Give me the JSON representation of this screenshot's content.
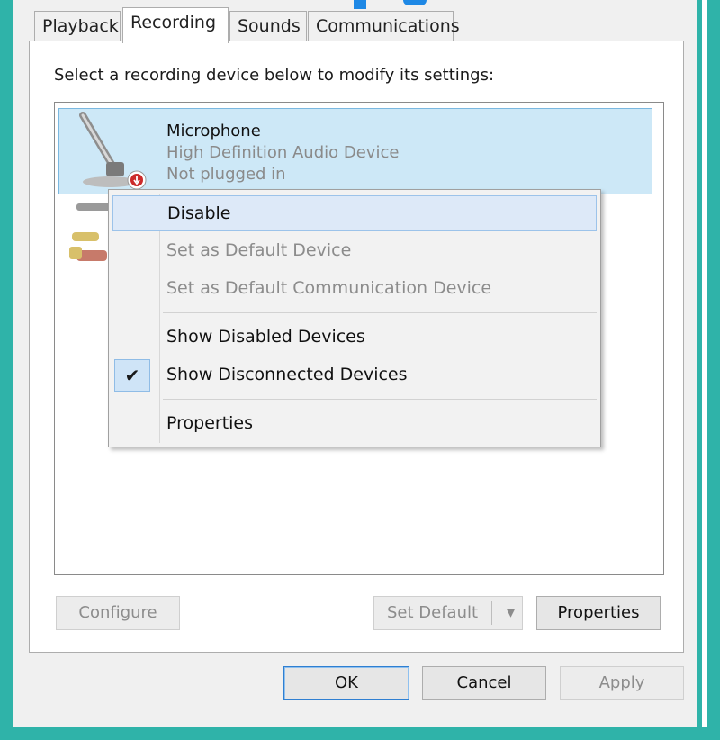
{
  "tabs": [
    {
      "label": "Playback"
    },
    {
      "label": "Recording"
    },
    {
      "label": "Sounds"
    },
    {
      "label": "Communications"
    }
  ],
  "instruction": "Select a recording device below to modify its settings:",
  "device": {
    "name": "Microphone",
    "subtitle": "High Definition Audio Device",
    "status": "Not plugged in"
  },
  "context_menu": {
    "items": [
      {
        "label": "Disable"
      },
      {
        "label": "Set as Default Device"
      },
      {
        "label": "Set as Default Communication Device"
      },
      {
        "label": "Show Disabled Devices"
      },
      {
        "label": "Show Disconnected Devices",
        "checked": true
      },
      {
        "label": "Properties"
      }
    ],
    "check_glyph": "✔"
  },
  "buttons": {
    "configure": "Configure",
    "set_default": "Set Default",
    "set_default_arrow": "▾",
    "properties": "Properties",
    "ok": "OK",
    "cancel": "Cancel",
    "apply": "Apply"
  },
  "colors": {
    "selection": "#cde8f7",
    "accent_teal": "#2fb3a9",
    "menu_hover": "#dde9f8"
  }
}
